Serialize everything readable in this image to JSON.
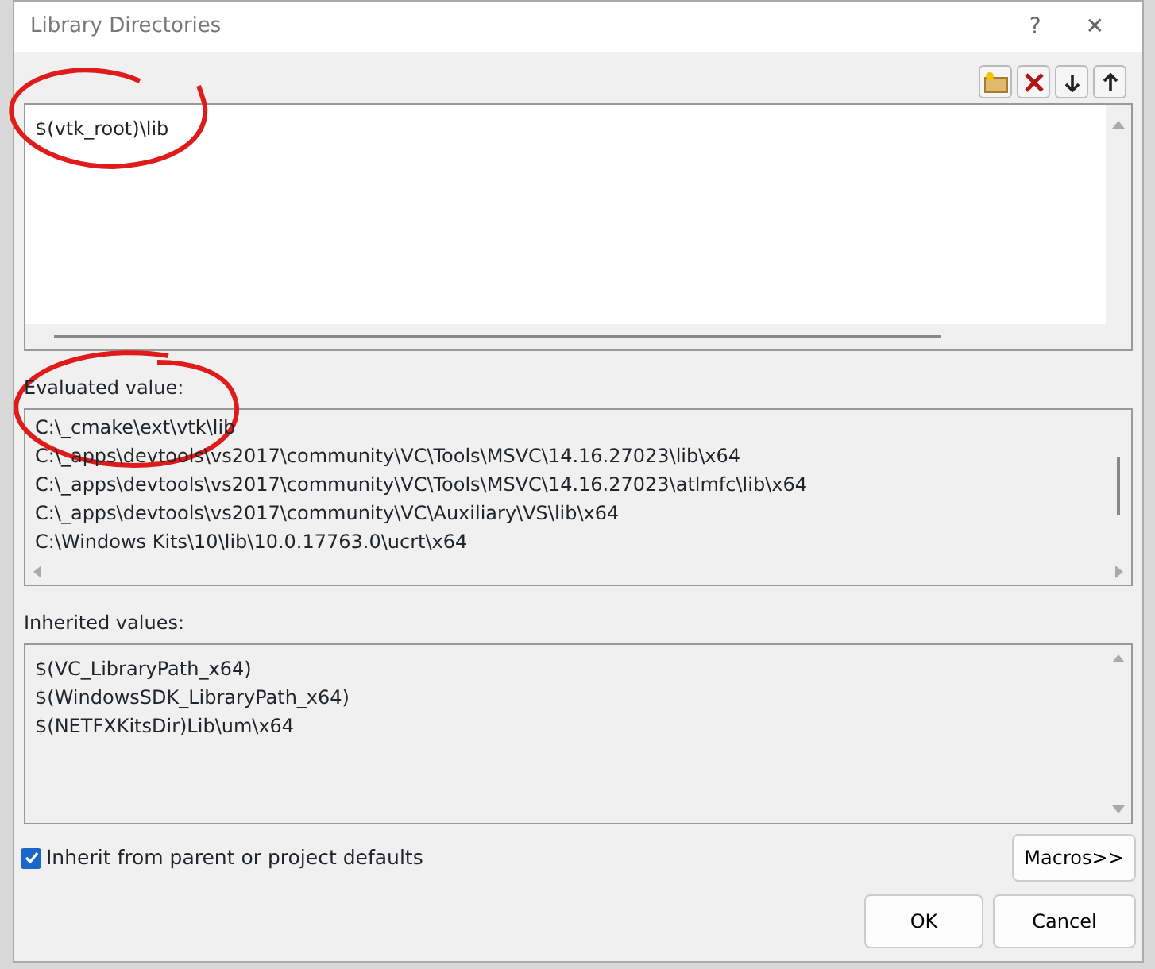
{
  "window": {
    "title": "Library Directories",
    "help": "?",
    "close": "✕"
  },
  "edit_box": {
    "lines": [
      "$(vtk_root)\\lib"
    ]
  },
  "evaluated": {
    "label": "Evaluated value:",
    "lines": [
      "C:\\_cmake\\ext\\vtk\\lib",
      "C:\\_apps\\devtools\\vs2017\\community\\VC\\Tools\\MSVC\\14.16.27023\\lib\\x64",
      "C:\\_apps\\devtools\\vs2017\\community\\VC\\Tools\\MSVC\\14.16.27023\\atlmfc\\lib\\x64",
      "C:\\_apps\\devtools\\vs2017\\community\\VC\\Auxiliary\\VS\\lib\\x64",
      "C:\\Windows Kits\\10\\lib\\10.0.17763.0\\ucrt\\x64"
    ]
  },
  "inherited": {
    "label": "Inherited values:",
    "lines": [
      "$(VC_LibraryPath_x64)",
      "$(WindowsSDK_LibraryPath_x64)",
      "$(NETFXKitsDir)Lib\\um\\x64"
    ]
  },
  "inherit_checkbox": {
    "label": "Inherit from parent or project defaults",
    "checked": true
  },
  "buttons": [
    {
      "label": "Macros>>",
      "kind": "macros"
    },
    {
      "label": "OK",
      "kind": "ok"
    },
    {
      "label": "Cancel",
      "kind": "cancel"
    }
  ]
}
